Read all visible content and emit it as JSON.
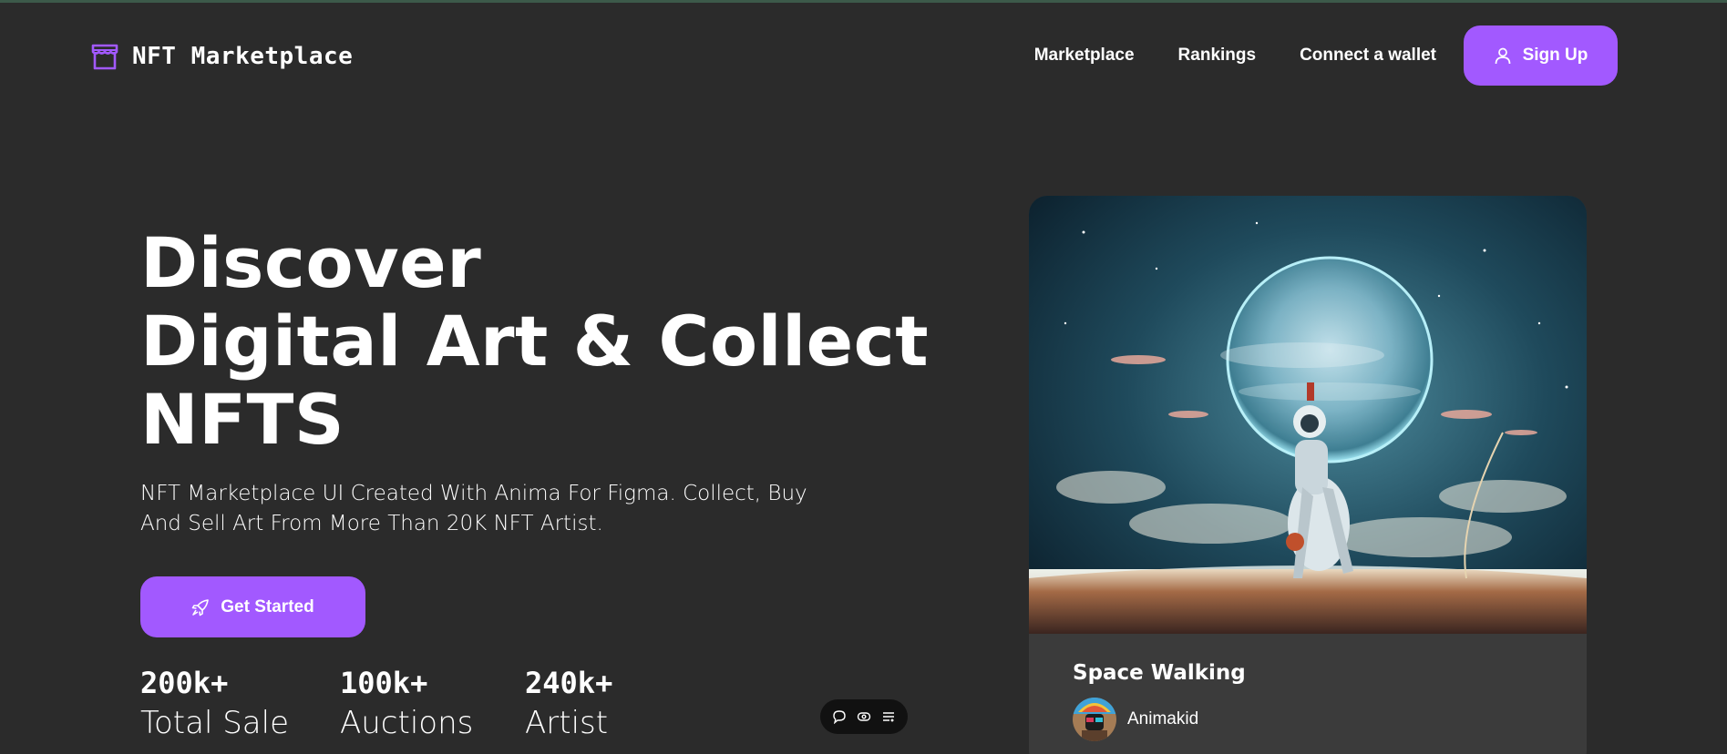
{
  "header": {
    "logo_text": "NFT Marketplace",
    "nav": [
      "Marketplace",
      "Rankings",
      "Connect a wallet"
    ],
    "signup_label": "Sign Up"
  },
  "hero": {
    "title_lines": [
      "Discover",
      "Digital Art & Collect",
      "NFTS"
    ],
    "subtitle": "NFT Marketplace UI Created With Anima For Figma. Collect, Buy And Sell Art From More Than 20K NFT Artist.",
    "cta_label": "Get Started",
    "stats": [
      {
        "value": "200k+",
        "label": "Total Sale"
      },
      {
        "value": "100k+",
        "label": "Auctions"
      },
      {
        "value": "240k+",
        "label": "Artist"
      }
    ]
  },
  "card": {
    "title": "Space Walking",
    "artist": "Animakid"
  },
  "colors": {
    "background": "#2b2b2b",
    "accent": "#a259ff",
    "card": "#3b3b3b"
  },
  "icons": {
    "logo": "storefront-icon",
    "signup": "user-icon",
    "cta": "rocket-icon",
    "toolbar": [
      "comment-icon",
      "eye-icon",
      "list-icon"
    ]
  }
}
